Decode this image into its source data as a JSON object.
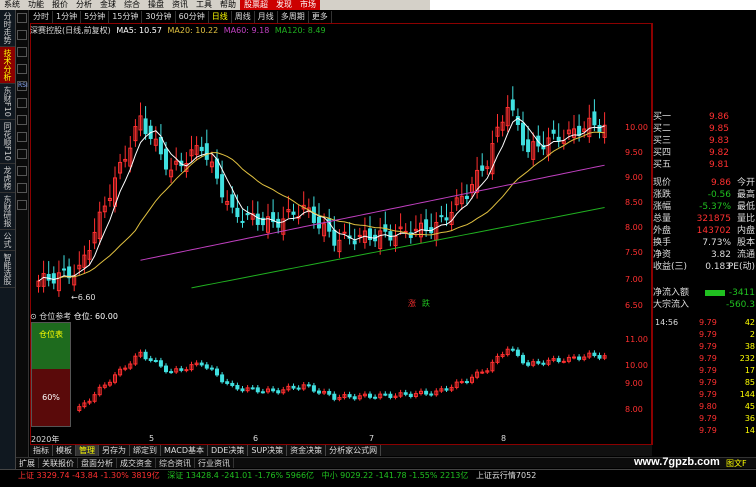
{
  "menu": [
    "系统",
    "功能",
    "报价",
    "分析",
    "金球",
    "综合",
    "操盘",
    "资讯",
    "工具",
    "帮助",
    "股票超",
    "发现",
    "市场"
  ],
  "periods": [
    "分时",
    "1分钟",
    "5分钟",
    "15分钟",
    "30分钟",
    "60分钟",
    "日线",
    "周线",
    "月线",
    "多周期",
    "更多"
  ],
  "active_period": "日线",
  "left_tabs": [
    "分时走势",
    "技术分析",
    "东财F10",
    "同花顺F10",
    "龙虎榜",
    "东财研报",
    "公式",
    "智能选股"
  ],
  "left_icon_labels": [
    "",
    "",
    "",
    "",
    "RSI",
    "",
    "",
    "",
    "",
    "",
    "",
    ""
  ],
  "legend": {
    "title": "深赛控股(日线,前复权)",
    "ma5": "MA5: 10.57",
    "ma20": "MA20: 10.22",
    "ma60": "MA60: 9.18",
    "ma120": "MA120: 8.49"
  },
  "ma_colors": {
    "ma5": "#ffffff",
    "ma20": "#e0c040",
    "ma60": "#c040c0",
    "ma120": "#20b020"
  },
  "low_label": "←6.60",
  "badges": [
    "涨",
    "跌"
  ],
  "price_axis": [
    "10.00",
    "9.50",
    "9.00",
    "8.50",
    "8.00",
    "7.50",
    "7.00",
    "6.50"
  ],
  "ind_axis": [
    "11.00",
    "10.00",
    "9.00",
    "8.00"
  ],
  "indicator": {
    "title": "⊙ 仓位参考",
    "subtitle": "仓位: 60.00",
    "top_label": "仓位表",
    "bottom_label": "60%"
  },
  "date_axis": [
    "2020年",
    "5",
    "6",
    "7",
    "8"
  ],
  "tabs_bottom": [
    "指标",
    "模板",
    "管理",
    "另存为",
    "绑定到",
    "MACD基本",
    "DDE决策",
    "SUP决策",
    "资金决策",
    "分析家公式网"
  ],
  "tabs_bottom2": [
    "扩展",
    "关联报价",
    "盘面分析",
    "成交资金",
    "综合资讯",
    "行业资讯"
  ],
  "orderbook": [
    {
      "label": "买一",
      "price": "9.86",
      "vol": ""
    },
    {
      "label": "买二",
      "price": "9.85",
      "vol": ""
    },
    {
      "label": "买三",
      "price": "9.83",
      "vol": ""
    },
    {
      "label": "买四",
      "price": "9.82",
      "vol": ""
    },
    {
      "label": "买五",
      "price": "9.81",
      "vol": ""
    }
  ],
  "quote": [
    {
      "label": "现价",
      "value": "9.86",
      "label2": "今开"
    },
    {
      "label": "涨跌",
      "value": "-0.56",
      "label2": "最高"
    },
    {
      "label": "涨幅",
      "value": "-5.37%",
      "label2": "最低"
    },
    {
      "label": "总量",
      "value": "321875",
      "label2": "量比"
    },
    {
      "label": "外盘",
      "value": "143702",
      "label2": "内盘"
    },
    {
      "label": "换手",
      "value": "7.73%",
      "label2": "股本"
    },
    {
      "label": "净资",
      "value": "3.82",
      "label2": "流通"
    },
    {
      "label": "收益(三)",
      "value": "0.183",
      "label2": "PE(动)"
    }
  ],
  "flow": [
    {
      "label": "净流入额",
      "value": "-3411"
    },
    {
      "label": "大宗流入",
      "value": "-560.3"
    }
  ],
  "ticks": [
    {
      "time": "14:56",
      "price": "9.79",
      "vol": "42"
    },
    {
      "time": "",
      "price": "9.79",
      "vol": "2"
    },
    {
      "time": "",
      "price": "9.79",
      "vol": "38"
    },
    {
      "time": "",
      "price": "9.79",
      "vol": "232"
    },
    {
      "time": "",
      "price": "9.79",
      "vol": "17"
    },
    {
      "time": "",
      "price": "9.79",
      "vol": "85"
    },
    {
      "time": "",
      "price": "9.79",
      "vol": "144"
    },
    {
      "time": "",
      "price": "9.80",
      "vol": "45"
    },
    {
      "time": "",
      "price": "9.79",
      "vol": "36"
    },
    {
      "time": "",
      "price": "9.79",
      "vol": "14"
    }
  ],
  "status": {
    "sh": "上证 3329.74 -43.84 -1.30% 3819亿",
    "sz": "深证 13428.4 -241.01 -1.76% 5966亿",
    "mid": "中小 9029.22 -141.78 -1.55% 2213亿",
    "cloud": "上证云行情7052",
    "tip": "图文F"
  },
  "watermark": "www.7gpzb.com"
}
